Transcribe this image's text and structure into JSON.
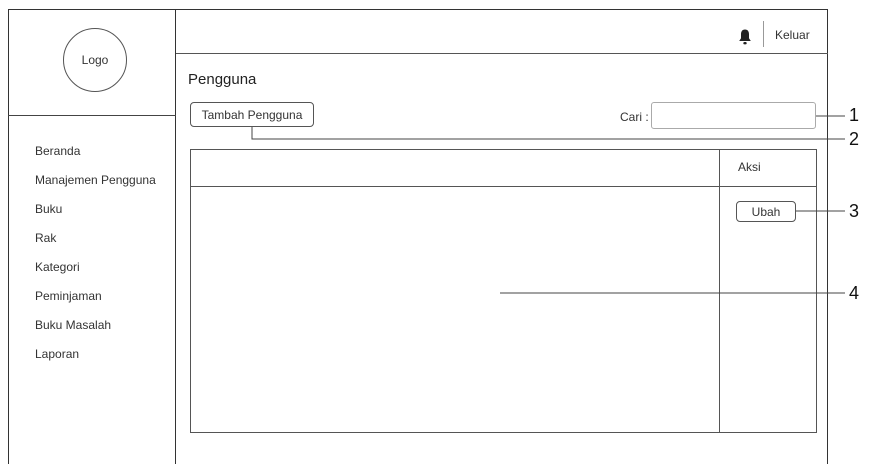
{
  "sidebar": {
    "logo_text": "Logo",
    "items": [
      {
        "label": "Beranda"
      },
      {
        "label": "Manajemen Pengguna"
      },
      {
        "label": "Buku"
      },
      {
        "label": "Rak"
      },
      {
        "label": "Kategori"
      },
      {
        "label": "Peminjaman"
      },
      {
        "label": "Buku Masalah"
      },
      {
        "label": "Laporan"
      }
    ]
  },
  "header": {
    "notification_icon": "bell-icon",
    "logout_label": "Keluar"
  },
  "main": {
    "title": "Pengguna",
    "add_button_label": "Tambah Pengguna",
    "search_label": "Cari :",
    "search_value": "",
    "table": {
      "columns": [
        "",
        "Aksi"
      ],
      "edit_button_label": "Ubah"
    }
  },
  "annotations": [
    "1",
    "2",
    "3",
    "4"
  ]
}
